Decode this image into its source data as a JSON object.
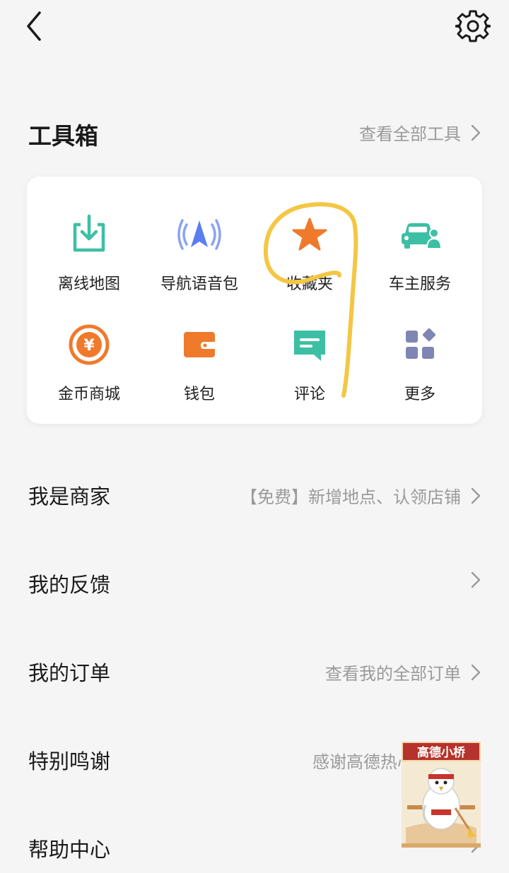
{
  "header": {
    "back_icon": "chevron-left-icon",
    "settings_icon": "gear-icon"
  },
  "toolbox": {
    "title": "工具箱",
    "view_all": "查看全部工具",
    "tools": [
      {
        "label": "离线地图",
        "icon": "offline-map-icon",
        "color": "#3cbfa5"
      },
      {
        "label": "导航语音包",
        "icon": "voice-pack-icon",
        "color": "#5b7df0"
      },
      {
        "label": "收藏夹",
        "icon": "star-icon",
        "color": "#ef7a2c"
      },
      {
        "label": "车主服务",
        "icon": "car-owner-icon",
        "color": "#3cbfa5"
      },
      {
        "label": "金币商城",
        "icon": "coin-icon",
        "color": "#ef7a2c"
      },
      {
        "label": "钱包",
        "icon": "wallet-icon",
        "color": "#ef7a2c"
      },
      {
        "label": "评论",
        "icon": "comment-icon",
        "color": "#3cbfa5"
      },
      {
        "label": "更多",
        "icon": "more-grid-icon",
        "color": "#7f86b3"
      }
    ]
  },
  "menu": [
    {
      "title": "我是商家",
      "subtitle": "【免费】新增地点、认领店铺"
    },
    {
      "title": "我的反馈",
      "subtitle": ""
    },
    {
      "title": "我的订单",
      "subtitle": "查看我的全部订单"
    },
    {
      "title": "特别鸣谢",
      "subtitle": "感谢高德热心"
    },
    {
      "title": "帮助中心",
      "subtitle": ""
    }
  ],
  "mascot": {
    "label": "高德小桥"
  },
  "colors": {
    "background": "#f5f5f5",
    "card": "#ffffff",
    "annotation": "#f4c644",
    "muted": "#9a9a9a"
  }
}
